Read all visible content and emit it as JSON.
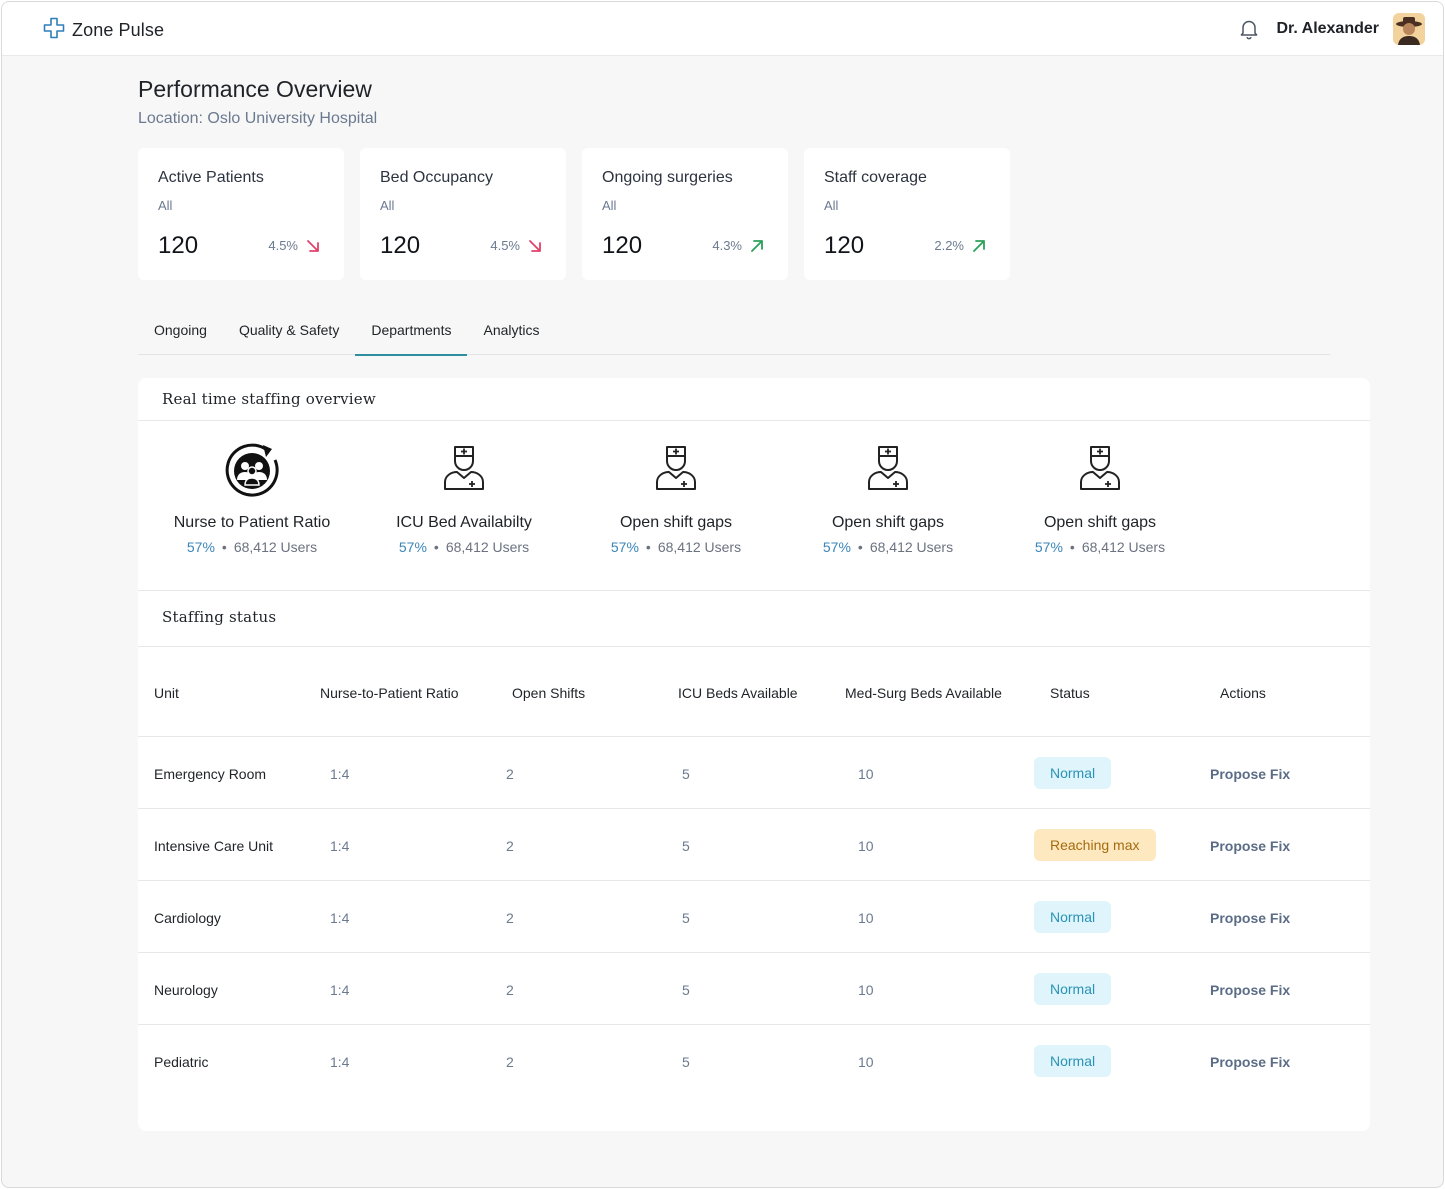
{
  "app": {
    "name": "Zone Pulse"
  },
  "user": {
    "name": "Dr. Alexander"
  },
  "colors": {
    "accent": "#2f8fa0",
    "normal_badge": "#dff4fb",
    "warn_badge": "#fde8c0",
    "trend_down": "#e0426a",
    "trend_up": "#2aa05a"
  },
  "page": {
    "title": "Performance Overview",
    "subtitle": "Location: Oslo University Hospital"
  },
  "kpis": [
    {
      "title": "Active Patients",
      "scope": "All",
      "value": "120",
      "change": "4.5%",
      "direction": "down"
    },
    {
      "title": "Bed Occupancy",
      "scope": "All",
      "value": "120",
      "change": "4.5%",
      "direction": "down"
    },
    {
      "title": "Ongoing surgeries",
      "scope": "All",
      "value": "120",
      "change": "4.3%",
      "direction": "up"
    },
    {
      "title": "Staff coverage",
      "scope": "All",
      "value": "120",
      "change": "2.2%",
      "direction": "up"
    }
  ],
  "tabs": [
    {
      "label": "Ongoing",
      "active": false
    },
    {
      "label": "Quality & Safety",
      "active": false
    },
    {
      "label": "Departments",
      "active": true
    },
    {
      "label": "Analytics",
      "active": false
    }
  ],
  "overview": {
    "title": "Real time staffing overview",
    "stats": [
      {
        "label": "Nurse to Patient Ratio",
        "pct": "57%",
        "users": "68,412 Users",
        "icon": "team-cycle-icon"
      },
      {
        "label": "ICU Bed Availabilty",
        "pct": "57%",
        "users": "68,412 Users",
        "icon": "nurse-icon"
      },
      {
        "label": "Open shift gaps",
        "pct": "57%",
        "users": "68,412 Users",
        "icon": "nurse-icon"
      },
      {
        "label": "Open shift gaps",
        "pct": "57%",
        "users": "68,412 Users",
        "icon": "nurse-icon"
      },
      {
        "label": "Open shift gaps",
        "pct": "57%",
        "users": "68,412 Users",
        "icon": "nurse-icon"
      }
    ]
  },
  "staffing": {
    "title": "Staffing status",
    "columns": [
      "Unit",
      "Nurse-to-Patient Ratio",
      "Open Shifts",
      "ICU Beds Available",
      "Med-Surg Beds Available",
      "Status",
      "Actions"
    ],
    "rows": [
      {
        "unit": "Emergency Room",
        "ratio": "1:4",
        "open_shifts": "2",
        "icu_beds": "5",
        "medsurg_beds": "10",
        "status": "Normal",
        "status_type": "normal",
        "action": "Propose Fix"
      },
      {
        "unit": "Intensive Care Unit",
        "ratio": "1:4",
        "open_shifts": "2",
        "icu_beds": "5",
        "medsurg_beds": "10",
        "status": "Reaching max",
        "status_type": "warn",
        "action": "Propose Fix"
      },
      {
        "unit": "Cardiology",
        "ratio": "1:4",
        "open_shifts": "2",
        "icu_beds": "5",
        "medsurg_beds": "10",
        "status": "Normal",
        "status_type": "normal",
        "action": "Propose Fix"
      },
      {
        "unit": "Neurology",
        "ratio": "1:4",
        "open_shifts": "2",
        "icu_beds": "5",
        "medsurg_beds": "10",
        "status": "Normal",
        "status_type": "normal",
        "action": "Propose Fix"
      },
      {
        "unit": "Pediatric",
        "ratio": "1:4",
        "open_shifts": "2",
        "icu_beds": "5",
        "medsurg_beds": "10",
        "status": "Normal",
        "status_type": "normal",
        "action": "Propose Fix"
      }
    ]
  }
}
